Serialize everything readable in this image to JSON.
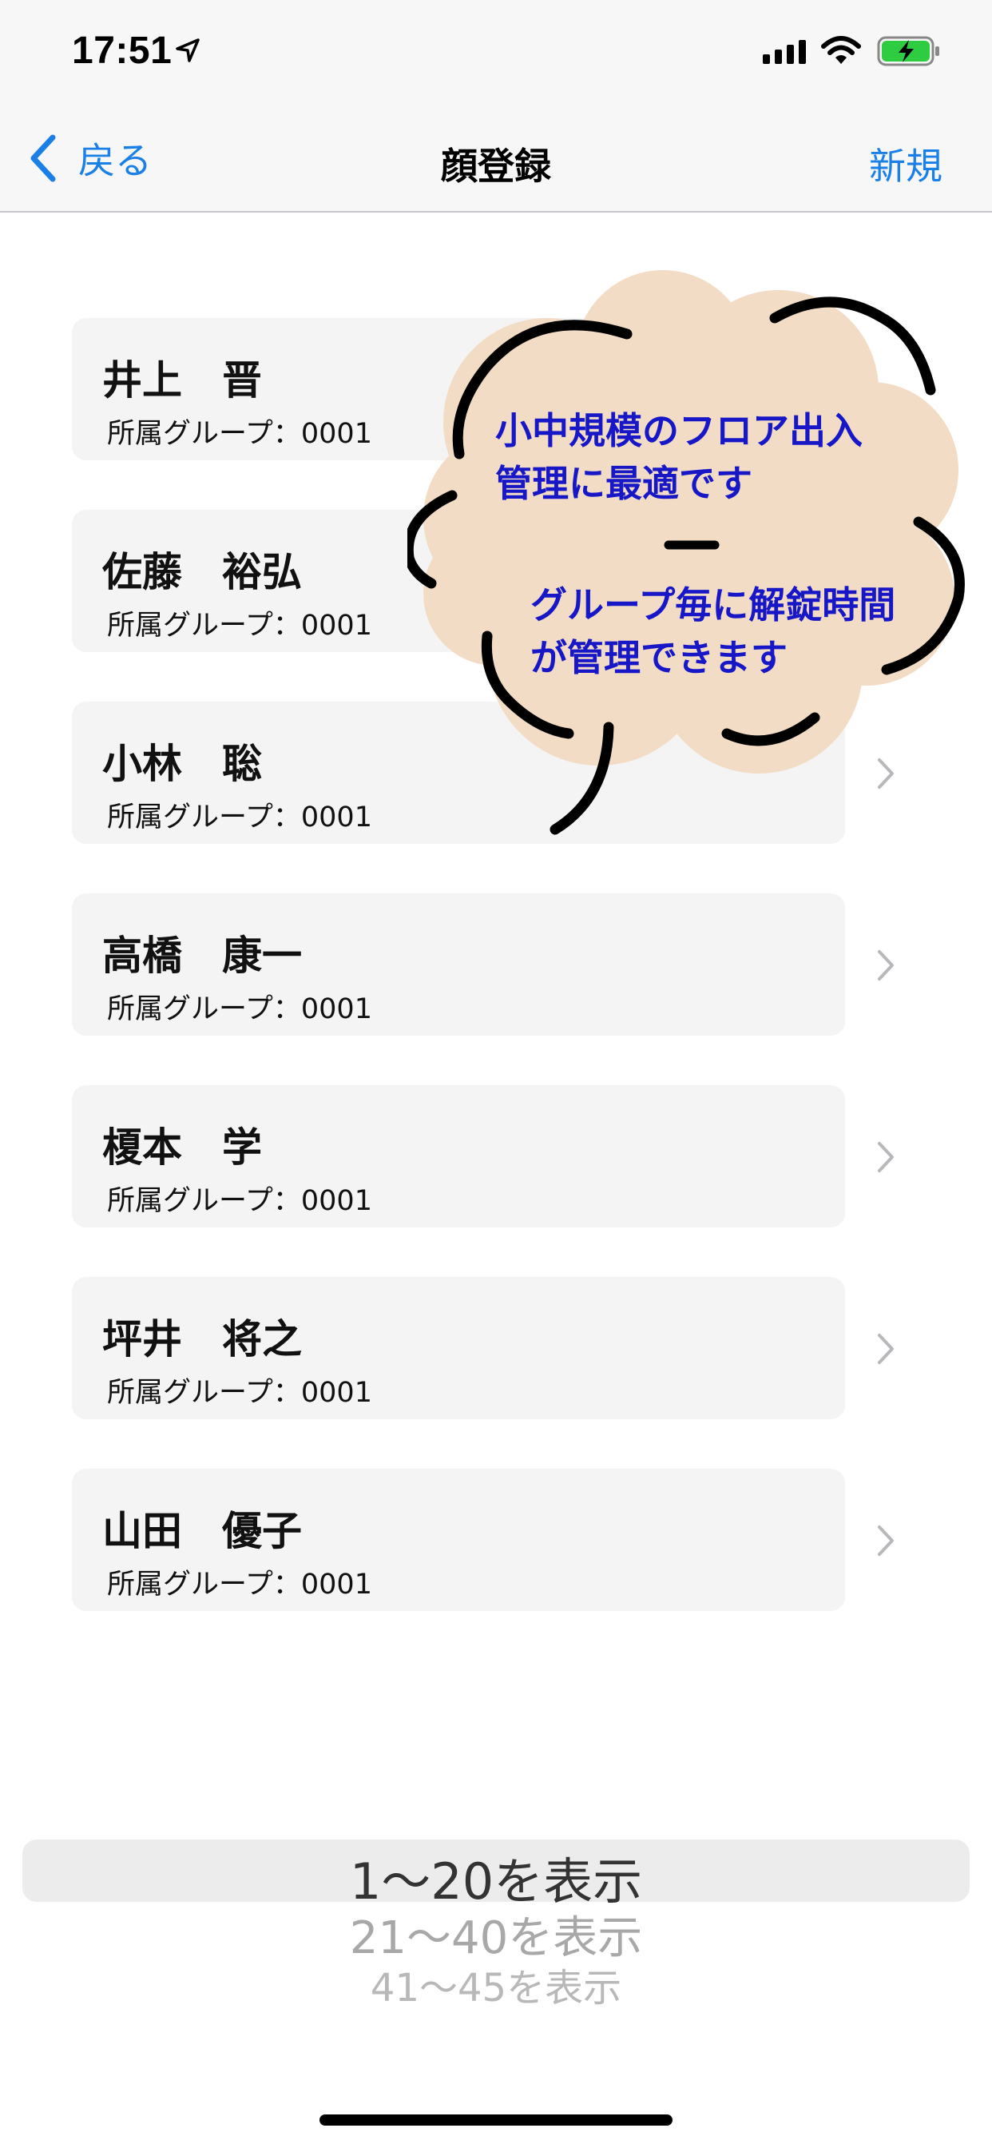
{
  "status_bar": {
    "time": "17:51",
    "battery_color": "#2ecc40"
  },
  "nav": {
    "back_label": "戻る",
    "title": "顔登録",
    "new_label": "新規",
    "accent_color": "#1a7fe6"
  },
  "people": [
    {
      "name": "井上　晋",
      "group": "所属グループ：0001"
    },
    {
      "name": "佐藤　裕弘",
      "group": "所属グループ：0001"
    },
    {
      "name": "小林　聡",
      "group": "所属グループ：0001"
    },
    {
      "name": "高橋　康一",
      "group": "所属グループ：0001"
    },
    {
      "name": "榎本　学",
      "group": "所属グループ：0001"
    },
    {
      "name": "坪井　将之",
      "group": "所属グループ：0001"
    },
    {
      "name": "山田　優子",
      "group": "所属グループ：0001"
    }
  ],
  "callout": {
    "line1": "小中規模のフロア出入",
    "line2": "管理に最適です",
    "line3": "グループ毎に解錠時間",
    "line4": "が管理できます",
    "fill_color": "#f2dcc5",
    "text_color": "#1717c7"
  },
  "picker": {
    "options": [
      "1〜20を表示",
      "21〜40を表示",
      "41〜45を表示"
    ],
    "selected_index": 0
  }
}
